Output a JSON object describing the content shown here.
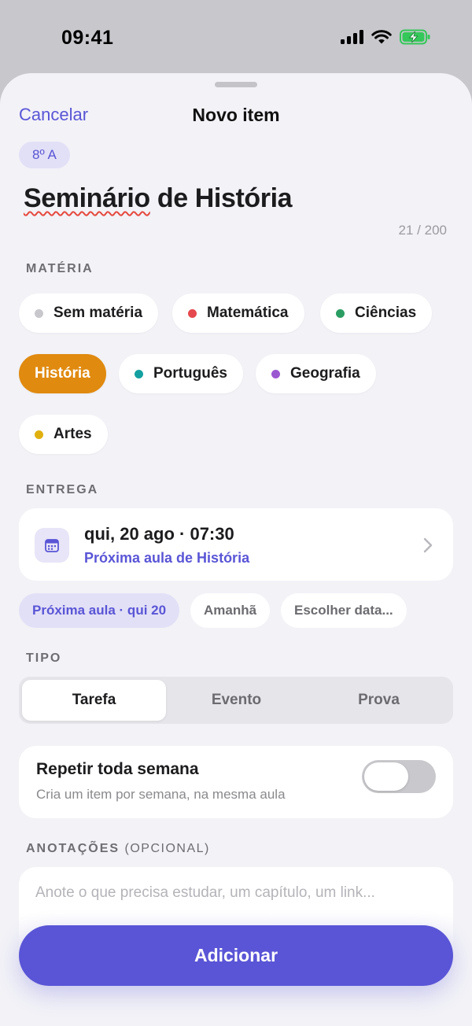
{
  "status_bar": {
    "time": "09:41"
  },
  "nav": {
    "cancel_label": "Cancelar",
    "title": "Novo item"
  },
  "class_badge": "8º A",
  "item_title": {
    "misspelled": "Seminário",
    "rest": " de História"
  },
  "char_count": "21 / 200",
  "subject_section": {
    "label": "MATÉRIA",
    "chips": [
      {
        "label": "Sem matéria",
        "color": "#c7c7cc",
        "selected": false
      },
      {
        "label": "Matemática",
        "color": "#e5484d",
        "selected": false
      },
      {
        "label": "Ciências",
        "color": "#2a9d63",
        "selected": false
      },
      {
        "label": "História",
        "color": "#e08a0f",
        "selected": true
      },
      {
        "label": "Português",
        "color": "#14a0a0",
        "selected": false
      },
      {
        "label": "Geografia",
        "color": "#9b59d0",
        "selected": false
      },
      {
        "label": "Artes",
        "color": "#e0b00f",
        "selected": false
      }
    ]
  },
  "delivery_section": {
    "label": "ENTREGA",
    "date_text": "qui, 20 ago · 07:30",
    "hint": "Próxima aula de História",
    "quick_options": [
      "Próxima aula · qui 20",
      "Amanhã",
      "Escolher data..."
    ]
  },
  "type_section": {
    "label": "TIPO",
    "options": [
      "Tarefa",
      "Evento",
      "Prova"
    ],
    "selected": "Tarefa"
  },
  "repeat": {
    "title": "Repetir toda semana",
    "subtitle": "Cria um item por semana, na mesma aula",
    "enabled": false
  },
  "notes_section": {
    "label": "ANOTAÇÕES",
    "optional": "(OPCIONAL)",
    "placeholder": "Anote o que precisa estudar, um capítulo, um link..."
  },
  "submit_label": "Adicionar",
  "colors": {
    "accent": "#5a55d6",
    "selected_subject": "#e08a0f",
    "background": "#f2f2f7"
  }
}
